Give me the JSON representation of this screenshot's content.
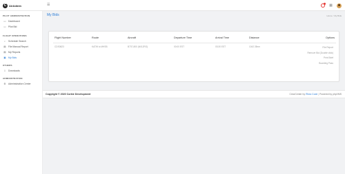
{
  "header": {
    "brand_mark": "C",
    "brand_name": "AirAdmin",
    "menu_icon": "☰",
    "icons": [
      "notification-bell-icon",
      "grid-icon",
      "user-avatar"
    ]
  },
  "sidebar": {
    "sections": [
      {
        "title": "PILOT ADMINISTRATION",
        "items": [
          {
            "label": "Dashboard",
            "icon": "▭",
            "active": false
          },
          {
            "label": "Pilot Bid",
            "icon": "▭",
            "active": false
          }
        ]
      },
      {
        "title": "FLIGHT OPERATIONS",
        "items": [
          {
            "label": "Schedule Search",
            "icon": "⌕",
            "active": false
          },
          {
            "label": "File Manual Report",
            "icon": "▤",
            "active": false
          },
          {
            "label": "My Reports",
            "icon": "▤",
            "active": false
          },
          {
            "label": "My Bids",
            "icon": "▣",
            "active": true
          }
        ]
      },
      {
        "title": "OTHERS",
        "items": [
          {
            "label": "Downloads",
            "icon": "⇩",
            "active": false
          }
        ]
      },
      {
        "title": "ADMINISTRATION",
        "items": [
          {
            "label": "Administration Center",
            "icon": "⚙",
            "active": false
          }
        ]
      }
    ]
  },
  "page": {
    "title": "My Bids",
    "breadcrumb": {
      "home": "Home",
      "separator": "/",
      "current": "My Bids"
    }
  },
  "table": {
    "headers": {
      "flight_number": "Flight Number",
      "route": "Route",
      "aircraft": "Aircraft",
      "departure": "Departure Time",
      "arrival": "Arrival Time",
      "distance": "Distance",
      "options": "Options"
    },
    "rows": [
      {
        "flight_number": "CDS0823",
        "route": "KATW to MHSB",
        "aircraft": "B737-800 (N012RO)",
        "departure": "00:00 EST",
        "arrival": "03:30 EST",
        "distance": "1042.35nm",
        "options": [
          "File Report",
          "Remove Bid (Double click)",
          "Print Brief",
          "Boarding Pass"
        ]
      }
    ]
  },
  "footer": {
    "copyright": "Copyright © 2020 Corkie Development",
    "crewcenter": "CrewCenter by",
    "author": "Rhea Code",
    "separator": "|",
    "powered": "Powered by phpVMS"
  }
}
